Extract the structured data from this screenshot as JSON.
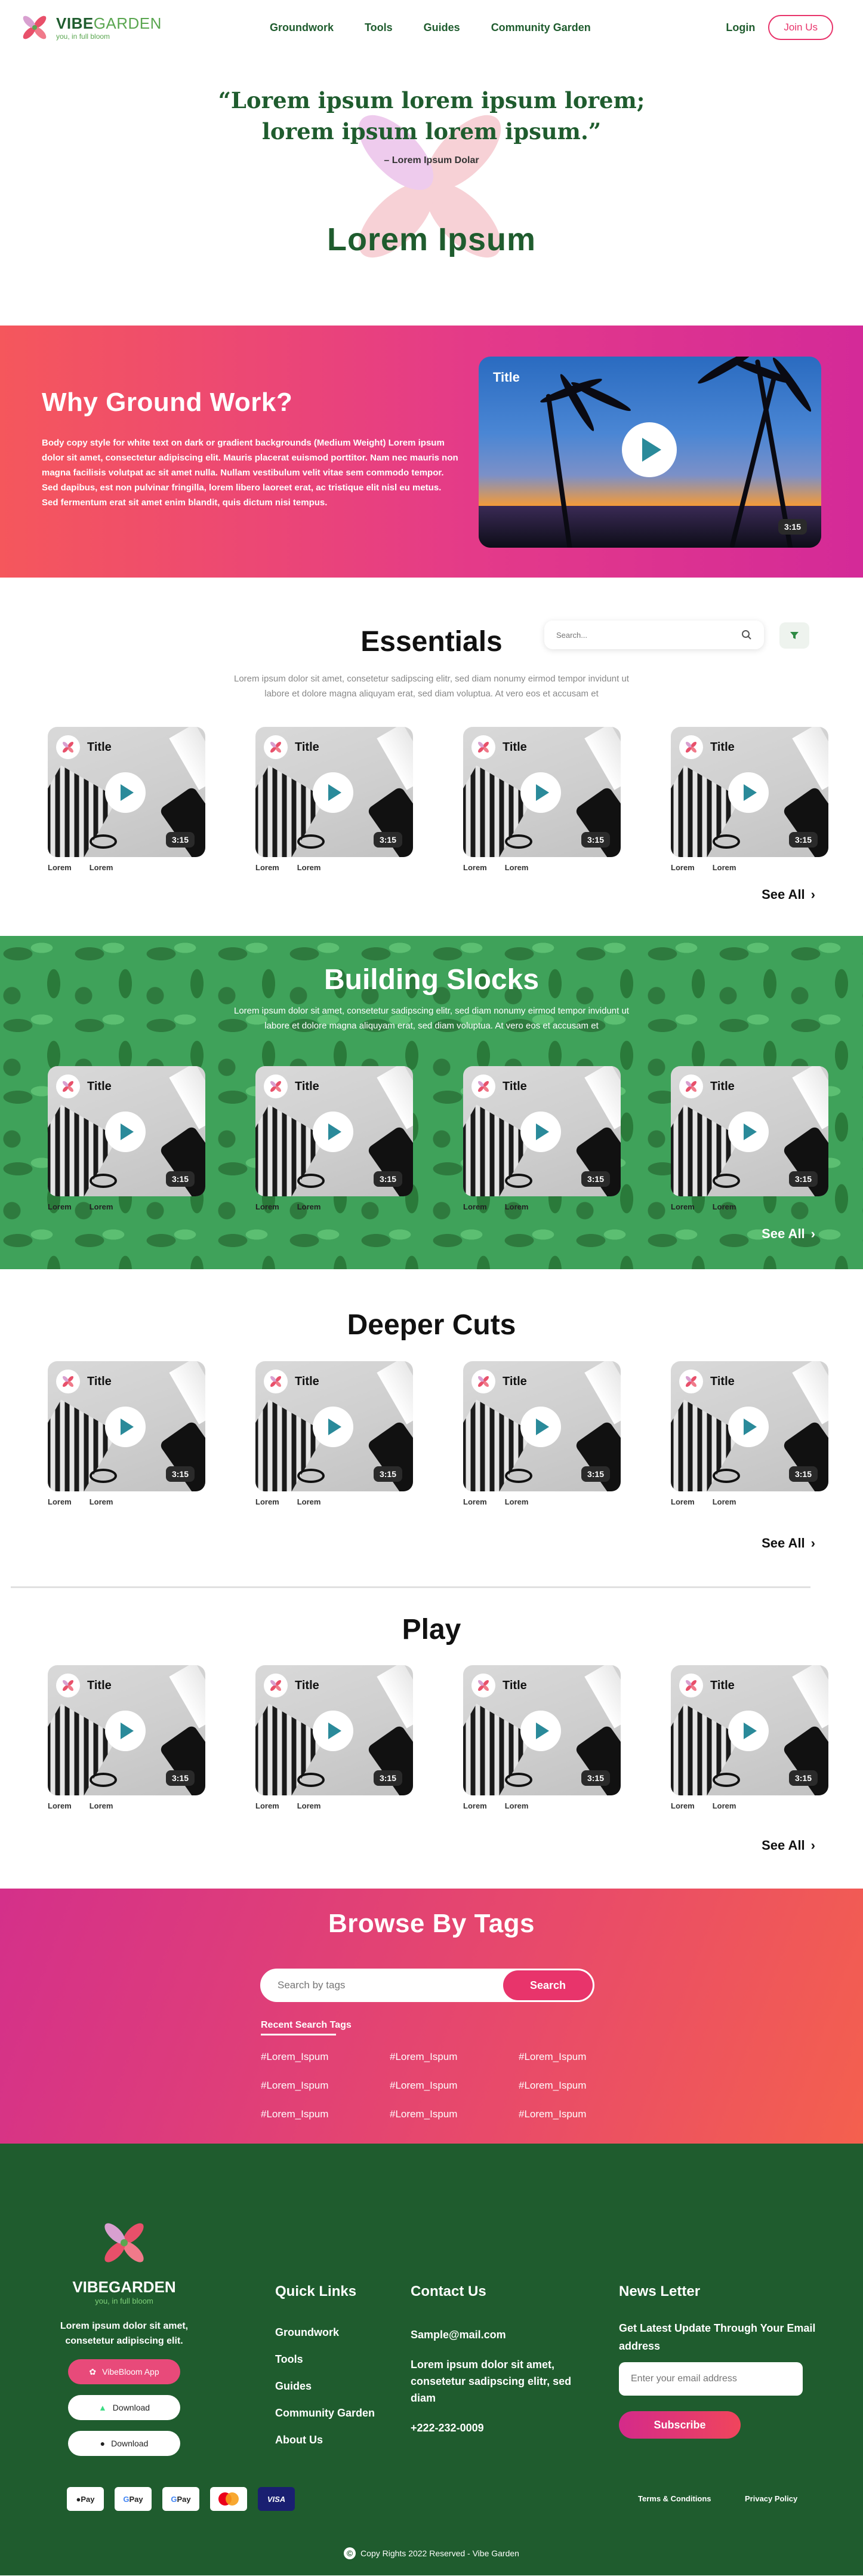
{
  "nav": {
    "logo_vibe": "VIBE",
    "logo_garden": "GARDEN",
    "tagline": "you, in full bloom",
    "links": [
      "Groundwork",
      "Tools",
      "Guides",
      "Community Garden"
    ],
    "login": "Login",
    "join": "Join Us"
  },
  "hero": {
    "quote_line1": "“Lorem ipsum lorem ipsum lorem;",
    "quote_line2": "lorem ipsum lorem ipsum.”",
    "author": "– Lorem Ipsum Dolar",
    "title": "Lorem Ipsum"
  },
  "why": {
    "title": "Why Ground Work?",
    "body": "Body copy style for white text on dark or gradient backgrounds (Medium Weight) Lorem ipsum dolor sit amet, consectetur adipiscing elit. Mauris placerat euismod porttitor. Nam nec mauris non magna facilisis volutpat ac sit amet nulla. Nullam vestibulum velit vitae sem commodo tempor. Sed dapibus, est non pulvinar fringilla, lorem libero laoreet erat, ac tristique elit nisl eu metus. Sed fermentum erat sit amet enim blandit, quis dictum nisi tempus.",
    "video_title": "Title",
    "video_duration": "3:15"
  },
  "card": {
    "title": "Title",
    "duration": "3:15",
    "meta1": "Lorem",
    "meta2": "Lorem"
  },
  "essentials": {
    "title": "Essentials",
    "search_placeholder": "Search...",
    "desc": "Lorem ipsum dolor sit amet, consetetur sadipscing elitr, sed diam nonumy eirmod tempor invidunt ut labore et dolore magna aliquyam erat, sed diam voluptua. At vero eos et accusam et",
    "see_all": "See All"
  },
  "building": {
    "title": "Building Slocks",
    "desc": "Lorem ipsum dolor sit amet, consetetur sadipscing elitr, sed diam nonumy eirmod tempor invidunt ut labore et dolore magna aliquyam erat, sed diam voluptua. At vero eos et accusam et",
    "see_all": "See All"
  },
  "deeper": {
    "title": "Deeper Cuts",
    "see_all": "See All"
  },
  "play": {
    "title": "Play",
    "see_all": "See All"
  },
  "tags": {
    "title": "Browse By Tags",
    "placeholder": "Search by tags",
    "button": "Search",
    "recent": "Recent Search Tags",
    "items": [
      "#Lorem_Ispum",
      "#Lorem_Ispum",
      "#Lorem_Ispum",
      "#Lorem_Ispum",
      "#Lorem_Ispum",
      "#Lorem_Ispum",
      "#Lorem_Ispum",
      "#Lorem_Ispum",
      "#Lorem_Ispum"
    ]
  },
  "footer": {
    "logo_vibe": "VIBE",
    "logo_garden": "GARDEN",
    "tagline": "you, in full bloom",
    "about": "Lorem ipsum dolor sit amet, consetetur adipiscing elit.",
    "app_vibebloom": "VibeBloom App",
    "download1": "Download",
    "download2": "Download",
    "quick_title": "Quick Links",
    "quick_links": [
      "Groundwork",
      "Tools",
      "Guides",
      "Community Garden",
      "About Us"
    ],
    "contact_title": "Contact Us",
    "email": "Sample@mail.com",
    "address": "Lorem ipsum dolor sit amet, consetetur sadipscing elitr, sed diam",
    "phone": "+222-232-0009",
    "news_title": "News Letter",
    "news_sub": "Get Latest Update Through Your Email address",
    "news_placeholder": "Enter your email address",
    "subscribe": "Subscribe",
    "payments": [
      "Pay",
      "Pay",
      "Pay",
      "",
      "VISA"
    ],
    "terms": "Terms & Conditions",
    "privacy": "Privacy Policy",
    "copyright": "Copy Rights 2022 Reserved - Vibe Garden"
  },
  "colors": {
    "brand_green": "#1f5c2e",
    "accent_pink": "#e8346b",
    "play_teal": "#2a8a9a"
  }
}
